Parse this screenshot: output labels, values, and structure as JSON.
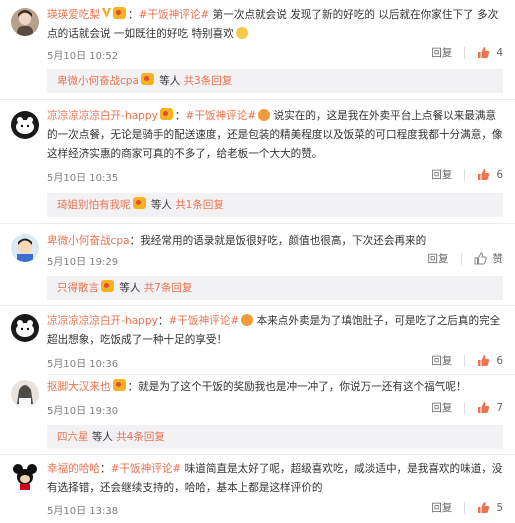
{
  "comments": [
    {
      "user": "瑛瑛爱吃梨",
      "text": "第一次点就会说 发现了新的好吃的 以后就在你家住下了 多次点的话就会说 一如既往的好吃 特别喜欢",
      "tag": "#干饭神评论#",
      "time": "5月10日 10:52",
      "reply_label": "回复",
      "likes": "4",
      "replies": {
        "name": "卑微小何奋战cpa",
        "suffix": "等人",
        "count_text": "共3条回复"
      }
    },
    {
      "user": "凉凉凉凉凉白开-happy",
      "text": "说实在的，这是我在外卖平台上点餐以来最满意的一次点餐，无论是骑手的配送速度，还是包装的精美程度以及饭菜的可口程度我都十分满意，像这样经济实惠的商家可真的不多了，给老板一个大大的赞。",
      "tag": "#干饭神评论#",
      "time": "5月10日 10:35",
      "reply_label": "回复",
      "likes": "6",
      "replies": {
        "name": "琦姐别怕有我呢",
        "suffix": "等人",
        "count_text": "共1条回复"
      }
    },
    {
      "user": "卑微小何奋战cpa",
      "text": "我经常用的语录就是饭很好吃，颜值也很高，下次还会再来的",
      "tag": "",
      "time": "5月10日 19:29",
      "reply_label": "回复",
      "likes": "赞",
      "replies": {
        "name": "只得散言",
        "suffix": "等人",
        "count_text": "共7条回复"
      }
    },
    {
      "user": "凉凉凉凉凉白开-happy",
      "text": "本来点外卖是为了填饱肚子，可是吃了之后真的完全超出想象，吃饭成了一种十足的享受！",
      "tag": "#干饭神评论#",
      "time": "5月10日 10:36",
      "reply_label": "回复",
      "likes": "6",
      "replies": null
    },
    {
      "user": "抠脚大汉来也",
      "text": "就是为了这个干饭的奖励我也是冲一冲了，你说万一还有这个福气呢！",
      "tag": "",
      "time": "5月10日 19:30",
      "reply_label": "回复",
      "likes": "7",
      "replies": {
        "name": "四六星",
        "suffix": "等人",
        "count_text": "共4条回复"
      }
    },
    {
      "user": "幸福的哈哈",
      "text": "味道简直是太好了呢，超级喜欢吃，咸淡适中，是我喜欢的味道，没有选择错，还会继续支持的，哈哈，基本上都是这样评价的",
      "tag": "#干饭神评论#",
      "time": "5月10日 13:38",
      "reply_label": "回复",
      "likes": "5",
      "replies": null
    }
  ],
  "colors": {
    "accent": "#eb7350",
    "meta": "#808080",
    "reply_bg": "#f2f2f5"
  }
}
